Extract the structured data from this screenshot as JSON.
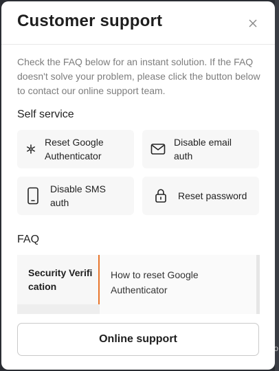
{
  "dialog": {
    "title": "Customer support",
    "close_icon": "close-icon"
  },
  "intro_text": "Check the FAQ below for an instant solution. If the FAQ doesn't solve your problem, please click the button below to contact our online support team.",
  "self_service": {
    "heading": "Self service",
    "items": [
      {
        "label": "Reset Google Authenticator",
        "icon": "authenticator-icon"
      },
      {
        "label": "Disable email auth",
        "icon": "email-icon"
      },
      {
        "label": "Disable SMS auth",
        "icon": "phone-icon"
      },
      {
        "label": "Reset password",
        "icon": "lock-icon"
      }
    ]
  },
  "faq": {
    "heading": "FAQ",
    "category": "Security Verification",
    "items": [
      "How to reset Google Authenticator"
    ],
    "accent_color": "#e8742a"
  },
  "online_support_label": "Online support"
}
